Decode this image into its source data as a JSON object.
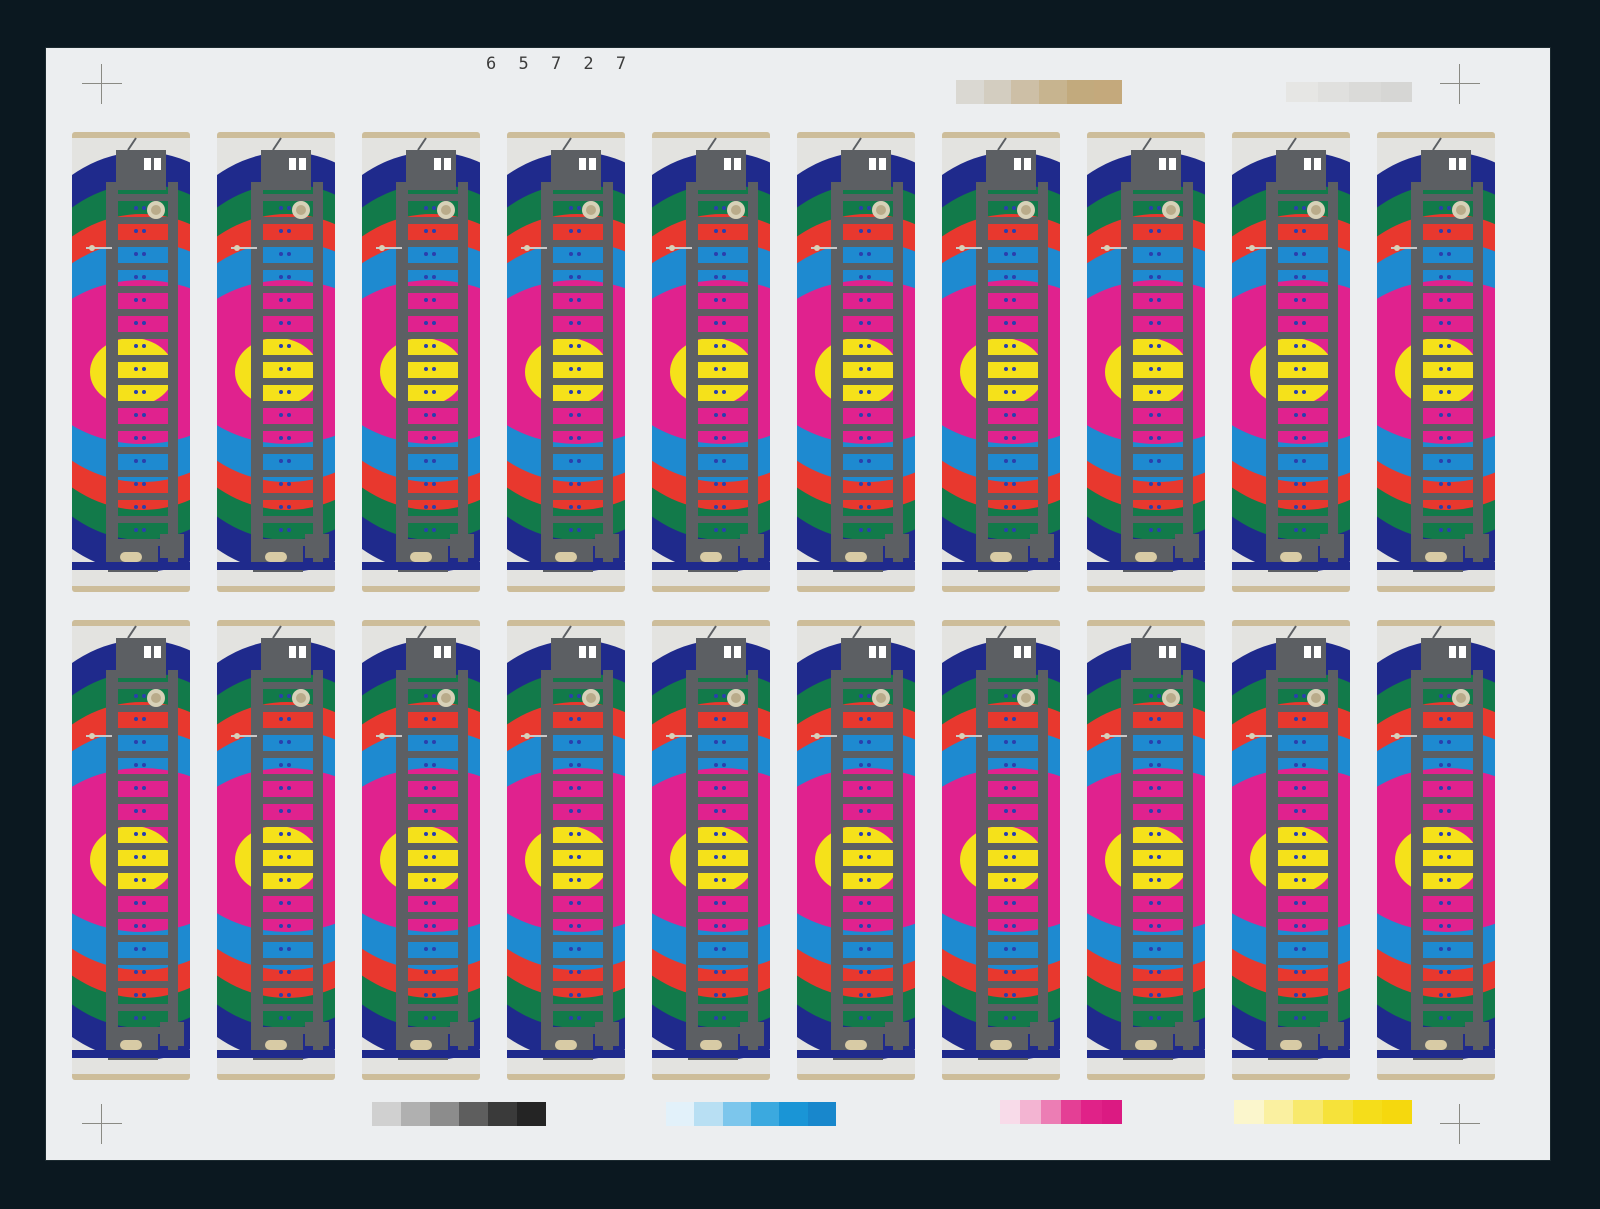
{
  "sheet": {
    "serial_number": "6 5 7 2 7",
    "rows": 2,
    "columns": 10
  },
  "colors": {
    "frame": "#0b1820",
    "paper": "#eceef0",
    "ring_outer_blue": "#1f2a8c",
    "ring_green": "#127a4a",
    "ring_red": "#e8382e",
    "ring_cyan": "#1e8ad0",
    "center_magenta": "#e0228e",
    "center_yellow": "#f5e11a",
    "motif_silver": "#5c5f63"
  },
  "color_bars": [
    {
      "name": "black",
      "shades": [
        "#d0d0d0",
        "#b0b0b0",
        "#8c8c8c",
        "#5e5e5e",
        "#3a3a3a",
        "#242424"
      ]
    },
    {
      "name": "cyan",
      "shades": [
        "#e2f1fa",
        "#b8dff3",
        "#7cc6ec",
        "#3ba9df",
        "#1a95d6",
        "#1887cc"
      ]
    },
    {
      "name": "magenta",
      "shades": [
        "#f8dbe9",
        "#f3b4d2",
        "#ec7db4",
        "#e43f95",
        "#e02288",
        "#db1a82"
      ]
    },
    {
      "name": "yellow",
      "shades": [
        "#fbf6cc",
        "#faf0a0",
        "#f8e96c",
        "#f6e23a",
        "#f5dd1a",
        "#f5d80e"
      ]
    },
    {
      "name": "tan",
      "shades": [
        "#dad8d2",
        "#d3cdc0",
        "#cdbfa6",
        "#c7b48f",
        "#c2aa7d",
        "#c4a97c"
      ]
    },
    {
      "name": "grey",
      "shades": [
        "#e6e6e4",
        "#e0e0de",
        "#dadad8",
        "#d6d6d4"
      ]
    }
  ]
}
